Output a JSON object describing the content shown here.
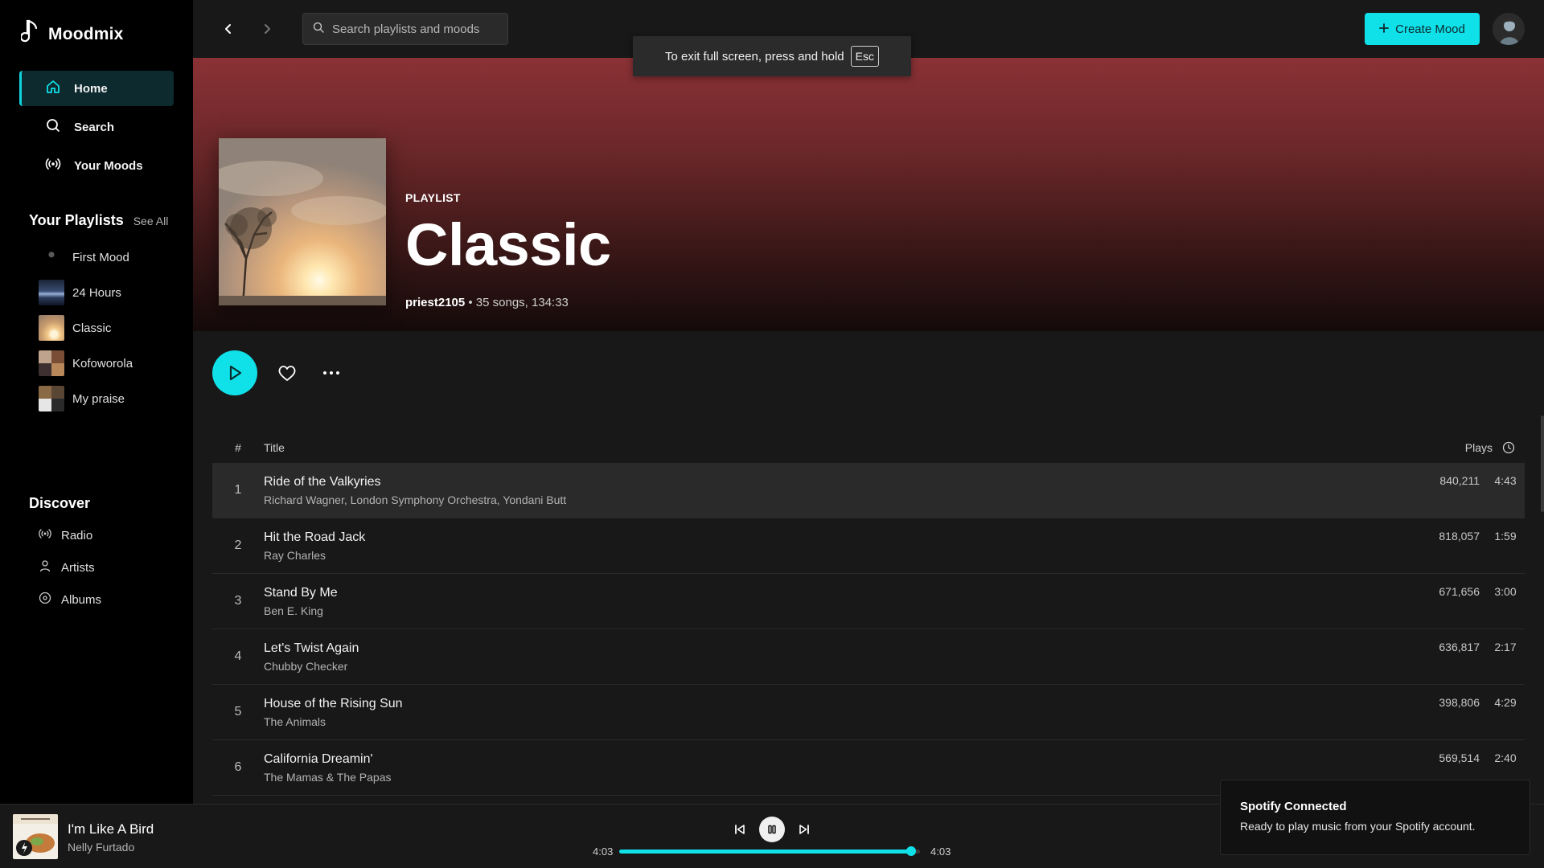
{
  "app": {
    "name": "Moodmix",
    "accent": "#10e0e8"
  },
  "nav": [
    {
      "label": "Home",
      "icon": "home-icon",
      "active": true
    },
    {
      "label": "Search",
      "icon": "search-icon",
      "active": false
    },
    {
      "label": "Your Moods",
      "icon": "radio-waves-icon",
      "active": false
    }
  ],
  "playlists_section": {
    "title": "Your Playlists",
    "see_all": "See All",
    "items": [
      {
        "label": "First Mood"
      },
      {
        "label": "24 Hours"
      },
      {
        "label": "Classic"
      },
      {
        "label": "Kofoworola"
      },
      {
        "label": "My praise"
      }
    ]
  },
  "discover": {
    "title": "Discover",
    "items": [
      {
        "label": "Radio",
        "icon": "radio-icon"
      },
      {
        "label": "Artists",
        "icon": "user-icon"
      },
      {
        "label": "Albums",
        "icon": "album-icon"
      }
    ]
  },
  "topbar": {
    "search_placeholder": "Search playlists and moods",
    "create_label": "Create Mood"
  },
  "fullscreen_notice": {
    "text": "To exit full screen, press and hold",
    "key": "Esc"
  },
  "playlist": {
    "type": "PLAYLIST",
    "title": "Classic",
    "owner": "priest2105",
    "meta": " • 35 songs, 134:33"
  },
  "track_table": {
    "col_num": "#",
    "col_title": "Title",
    "col_plays": "Plays",
    "rows": [
      {
        "num": "1",
        "title": "Ride of the Valkyries",
        "artist": "Richard Wagner, London Symphony Orchestra, Yondani Butt",
        "plays": "840,211",
        "duration": "4:43"
      },
      {
        "num": "2",
        "title": "Hit the Road Jack",
        "artist": "Ray Charles",
        "plays": "818,057",
        "duration": "1:59"
      },
      {
        "num": "3",
        "title": "Stand By Me",
        "artist": "Ben E. King",
        "plays": "671,656",
        "duration": "3:00"
      },
      {
        "num": "4",
        "title": "Let's Twist Again",
        "artist": "Chubby Checker",
        "plays": "636,817",
        "duration": "2:17"
      },
      {
        "num": "5",
        "title": "House of the Rising Sun",
        "artist": "The Animals",
        "plays": "398,806",
        "duration": "4:29"
      },
      {
        "num": "6",
        "title": "California Dreamin'",
        "artist": "The Mamas & The Papas",
        "plays": "569,514",
        "duration": "2:40"
      }
    ]
  },
  "player": {
    "title": "I'm Like A Bird",
    "artist": "Nelly Furtado",
    "elapsed": "4:03",
    "total": "4:03",
    "progress_fraction": 0.97
  },
  "toast": {
    "title": "Spotify Connected",
    "message": "Ready to play music from your Spotify account."
  }
}
